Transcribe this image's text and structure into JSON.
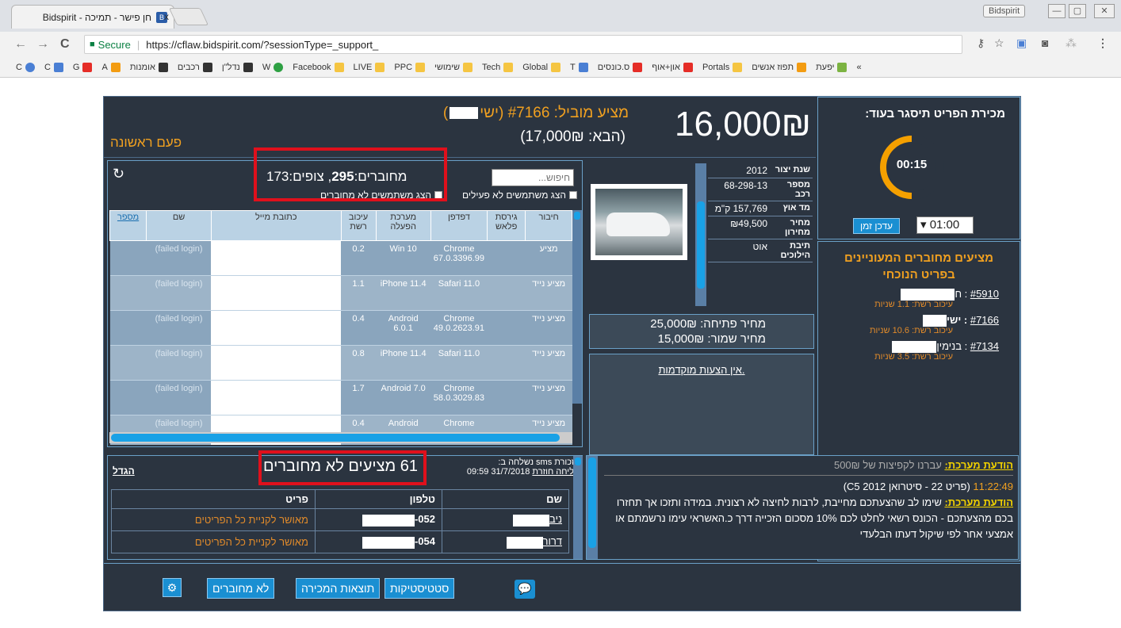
{
  "browser": {
    "tab_title": "חן פישר - תמיכה - Bidspirit",
    "tab_close": "x",
    "window_badge": "Bidspirit",
    "secure_label": "Secure",
    "url": "https://cflaw.bidspirit.com/?sessionType=_support_",
    "bookmarks": [
      "יפעת",
      "תפוז אנשים",
      "Portals",
      "און+אוף",
      "ס.כונסים",
      "T",
      "Global",
      "Tech",
      "שימושי",
      "PPC",
      "LIVE",
      "Facebook",
      "W",
      "נדל\"ן",
      "רכבים",
      "אומנות",
      "A",
      "G",
      "C",
      "C"
    ],
    "bookmark_overflow": "»"
  },
  "header": {
    "price": "16,000₪",
    "lead_bidder": "מציע מוביל: #7166 (ישי",
    "lead_bidder_close": ")",
    "next_bid": "(הבא: 17,000₪)",
    "first_time": "פעם ראשונה"
  },
  "timer": {
    "title": "מכירת הפריט תיסגר בעוד:",
    "remaining": "00:15",
    "progress": 0.25,
    "update_label": "עדכן זמן",
    "select_value": "01:00"
  },
  "bidders": {
    "title": "מציעים מחוברים המעוניינים בפריט הנוכחי",
    "items": [
      {
        "id": "#5910",
        "prefix": " : ח",
        "latency": "עיכוב רשת: 1.1 שניות"
      },
      {
        "id": "#7166",
        "prefix": " : ישי",
        "latency": "עיכוב רשת: 10.6 שניות"
      },
      {
        "id": "#7134",
        "prefix": " : בנימין",
        "latency": "עיכוב רשת: 3.5 שניות"
      }
    ]
  },
  "connections": {
    "search_placeholder": "חיפוש...",
    "counts_prefix": "מחוברים:",
    "connected": "295",
    "counts_mid": ", צופים:",
    "viewers": "173",
    "cb_inactive": "הצג משתמשים לא פעילים",
    "cb_disconnected": "הצג משתמשים לא מחוברים",
    "columns": [
      "חיבור",
      "גירסת פלאש",
      "דפדפן",
      "מערכת הפעלה",
      "עיכוב רשת",
      "כתובת מייל",
      "שם",
      "מספר"
    ],
    "rows": [
      {
        "type": "מציע",
        "flash": "",
        "browser": "Chrome 67.0.3396.99",
        "os": "Win 10",
        "latency": "0.2",
        "name": "(failed login)"
      },
      {
        "type": "מציע נייד",
        "flash": "",
        "browser": "Safari 11.0",
        "os": "iPhone 11.4",
        "latency": "1.1",
        "name": "(failed login)"
      },
      {
        "type": "מציע נייד",
        "flash": "",
        "browser": "Chrome 49.0.2623.91",
        "os": "Android 6.0.1",
        "latency": "0.4",
        "name": "(failed login)"
      },
      {
        "type": "מציע נייד",
        "flash": "",
        "browser": "Safari 11.0",
        "os": "iPhone 11.4",
        "latency": "0.8",
        "name": "(failed login)"
      },
      {
        "type": "מציע נייד",
        "flash": "",
        "browser": "Chrome 58.0.3029.83",
        "os": "Android 7.0",
        "latency": "1.7",
        "name": "(failed login)"
      },
      {
        "type": "מציע נייד",
        "flash": "",
        "browser": "Chrome",
        "os": "Android",
        "latency": "0.4",
        "name": "(failed login)"
      }
    ]
  },
  "item": {
    "specs": [
      {
        "label": "שנת יצור",
        "value": "2012"
      },
      {
        "label": "מספר רכב",
        "value": "68-298-13"
      },
      {
        "label": "מד אוץ",
        "value": "157,769 ק\"מ"
      },
      {
        "label": "מחיר מחירון",
        "value": "₪49,500"
      },
      {
        "label": "תיבת הילוכים",
        "value": "אוט"
      }
    ],
    "opening_price": "מחיר פתיחה: 25,000₪",
    "reserve_price": "מחיר שמור: 15,000₪",
    "no_advance_bids": "אין הצעות מוקדמות."
  },
  "not_connected": {
    "count_label": "61 מציעים לא מחוברים",
    "enlarge": "הגדל",
    "sms_label": "תזכורת sms נשלחה ב:",
    "sms_time": "31/7/2018 09:59",
    "resend": "שליחה חוזרת",
    "columns": [
      "שם",
      "טלפון",
      "פריט"
    ],
    "rows": [
      {
        "name": "ניב",
        "phone": "052-",
        "item": "מאושר לקניית כל הפריטים"
      },
      {
        "name": "דרור",
        "phone": "054-",
        "item": "מאושר לקניית כל הפריטים"
      }
    ]
  },
  "messages": {
    "m1_sys": "הודעת מערכת:",
    "m1_text": " עברנו לקפיצות של 500₪",
    "m2_time": "11:22:49",
    "m2_text": " (פריט 22 - סיטרואן C5 2012)",
    "m3_sys": "הודעת מערכת:",
    "m3_text": " שימו לב שהצעתכם מחייבת, לרבות לחיצה לא רצונית. במידה ותזכו אך תחזרו בכם מהצעתכם - הכונס רשאי לחלט לכם 10% מסכום הזכייה דרך כ.האשראי עימו נרשמתם או אמצעי אחר לפי שיקול דעתו הבלעדי"
  },
  "bottom": {
    "stats": "סטטיסטיקות",
    "results": "תוצאות המכירה",
    "not_connected": "לא מחוברים"
  },
  "colors": {
    "accent": "#1a8fd2",
    "orange": "#f0a020",
    "panel": "#2b3440",
    "highlight": "#e0101c"
  }
}
